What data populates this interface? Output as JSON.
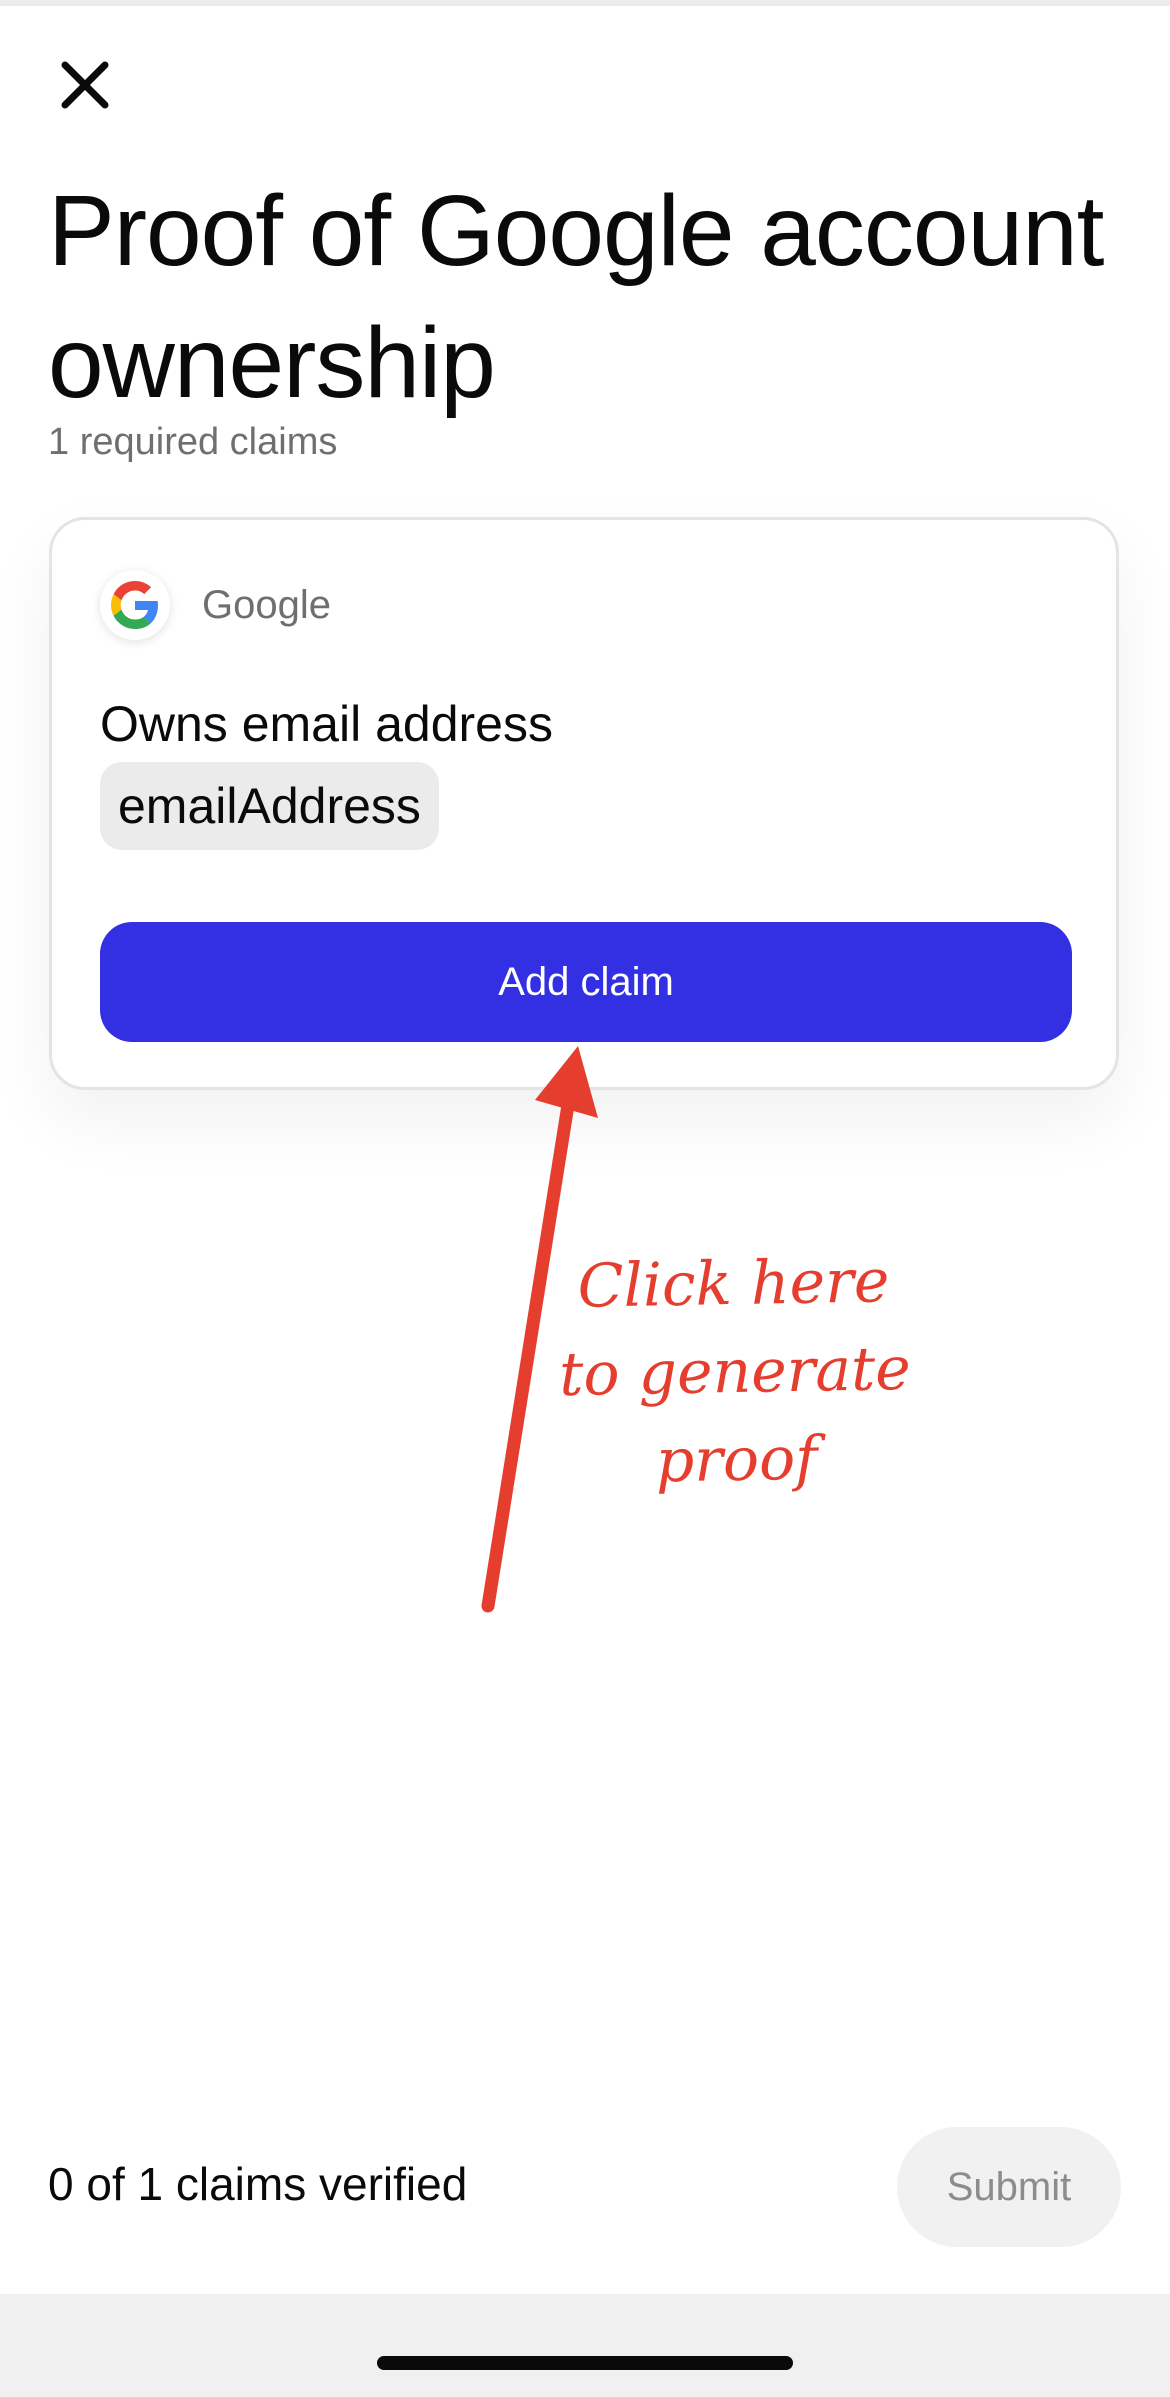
{
  "header": {
    "close_icon": "close-icon"
  },
  "page": {
    "title": "Proof of Google account ownership",
    "subtitle": "1 required claims"
  },
  "card": {
    "provider": {
      "name": "Google",
      "logo_icon": "google-logo-icon",
      "logo_colors": {
        "blue": "#4285F4",
        "red": "#EA4335",
        "yellow": "#FBBC05",
        "green": "#34A853"
      }
    },
    "claim_label": "Owns email address",
    "claim_field": "emailAddress",
    "add_claim_label": "Add claim",
    "button_color": "#3330E4"
  },
  "annotation": {
    "lines": [
      "Click here",
      "to generate",
      "proof"
    ],
    "color": "#E53E2F",
    "arrow_icon": "arrow-up-icon"
  },
  "footer": {
    "status": "0 of 1 claims verified",
    "submit_label": "Submit"
  }
}
